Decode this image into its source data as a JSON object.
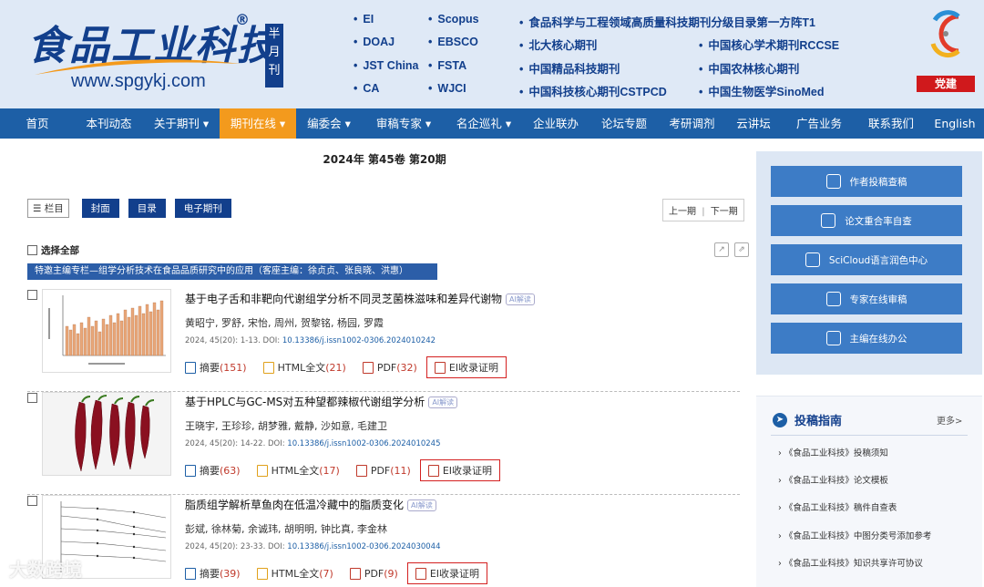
{
  "header": {
    "logo_text": "食品工业科技",
    "logo_reg": "®",
    "logo_url": "www.spgykj.com",
    "semi_monthly": "半月刊",
    "index_col1": [
      "EI",
      "DOAJ",
      "JST China",
      "CA"
    ],
    "index_col2": [
      "Scopus",
      "EBSCO",
      "FSTA",
      "WJCI"
    ],
    "index_col3": [
      "食品科学与工程领域高质量科技期刊分级目录第一方阵T1",
      "北大核心期刊",
      "中国精品科技期刊",
      "中国科技核心期刊CSTPCD"
    ],
    "index_col4": [
      "中国核心学术期刊RCCSE",
      "中国农林核心期刊",
      "中国生物医学SinoMed"
    ],
    "party_label": "党建"
  },
  "nav": [
    "首页",
    "本刊动态",
    "关于期刊 ▾",
    "期刊在线 ▾",
    "编委会 ▾",
    "审稿专家 ▾",
    "名企巡礼 ▾",
    "企业联办",
    "论坛专题",
    "考研调剂",
    "云讲坛",
    "广告业务",
    "联系我们",
    "English"
  ],
  "nav_active": 3,
  "issue_title": "2024年  第45卷  第20期",
  "toolbar": {
    "category": "☰ 栏目",
    "buttons": [
      "封面",
      "目录",
      "电子期刊"
    ],
    "prev": "上一期",
    "sep": "|",
    "next": "下一期",
    "select_all": "选择全部"
  },
  "special_banner": "特邀主编专栏—组学分析技术在食品品质研究中的应用（客座主编：徐贞贞、张良晓、洪惠）",
  "ai_tag": "AI解读",
  "articles": [
    {
      "title": "基于电子舌和非靶向代谢组学分析不同灵芝菌株滋味和差异代谢物",
      "authors": "黄昭宁, 罗舒, 宋怡, 周州, 贺黎铭, 杨园, 罗霞",
      "meta": "2024, 45(20): 1-13. DOI: ",
      "doi": "10.13386/j.issn1002-0306.2024010242",
      "abstract": "摘要",
      "abstract_n": "(151)",
      "html": "HTML全文",
      "html_n": "(21)",
      "pdf": "PDF",
      "pdf_n": "(32)",
      "ei": "EI收录证明"
    },
    {
      "title": "基于HPLC与GC-MS对五种望都辣椒代谢组学分析",
      "authors": "王晓宇, 王珍珍, 胡梦雅, 戴静, 沙如意, 毛建卫",
      "meta": "2024, 45(20): 14-22. DOI: ",
      "doi": "10.13386/j.issn1002-0306.2024010245",
      "abstract": "摘要",
      "abstract_n": "(63)",
      "html": "HTML全文",
      "html_n": "(17)",
      "pdf": "PDF",
      "pdf_n": "(11)",
      "ei": "EI收录证明"
    },
    {
      "title": "脂质组学解析草鱼肉在低温冷藏中的脂质变化",
      "authors": "彭斌, 徐林菊, 余诚玮, 胡明明, 钟比真, 李金林",
      "meta": "2024, 45(20): 23-33. DOI: ",
      "doi": "10.13386/j.issn1002-0306.2024030044",
      "abstract": "摘要",
      "abstract_n": "(39)",
      "html": "HTML全文",
      "html_n": "(7)",
      "pdf": "PDF",
      "pdf_n": "(9)",
      "ei": "EI收录证明"
    }
  ],
  "sidebar": [
    "作者投稿查稿",
    "论文重合率自查",
    "SciCloud语言润色中心",
    "专家在线审稿",
    "主编在线办公"
  ],
  "guide": {
    "title": "投稿指南",
    "more": "更多>",
    "items": [
      "《食品工业科技》投稿须知",
      "《食品工业科技》论文模板",
      "《食品工业科技》稿件自查表",
      "《食品工业科技》中图分类号添加参考",
      "《食品工业科技》知识共享许可协议"
    ]
  },
  "watermark": "大数跨境"
}
